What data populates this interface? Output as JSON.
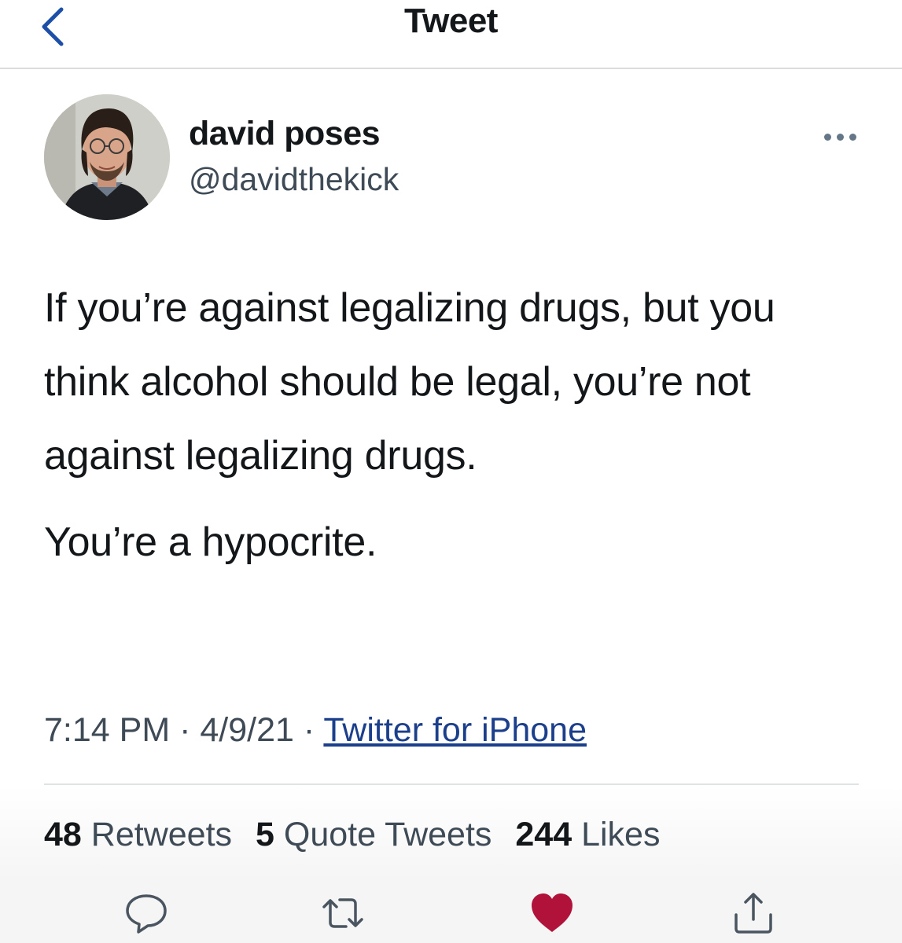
{
  "header": {
    "title": "Tweet",
    "back_icon": "chevron-left-icon",
    "accent": "#1d4fa8"
  },
  "author": {
    "display_name": "david poses",
    "handle": "@davidthekick",
    "avatar_icon": "avatar"
  },
  "tweet": {
    "paragraphs": [
      "If you’re against legalizing drugs, but you think alcohol should be legal, you’re not against legalizing drugs.",
      "You’re a hypocrite."
    ],
    "time": "7:14 PM",
    "separator": "·",
    "date": "4/9/21",
    "source": "Twitter for iPhone"
  },
  "stats": {
    "retweets_count": "48",
    "retweets_label": "Retweets",
    "quotes_count": "5",
    "quotes_label": "Quote Tweets",
    "likes_count": "244",
    "likes_label": "Likes"
  },
  "actions": {
    "reply_icon": "reply-icon",
    "retweet_icon": "retweet-icon",
    "like_icon": "heart-icon",
    "share_icon": "share-icon",
    "liked": true,
    "like_color": "#c2143a"
  },
  "more_icon": "more-icon"
}
